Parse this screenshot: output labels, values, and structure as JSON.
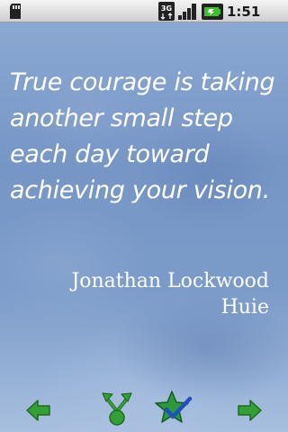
{
  "status_bar": {
    "network_label": "3G",
    "time": "1:51 AM",
    "icons": [
      "sd-card-icon",
      "3g-data-icon",
      "signal-strength-icon",
      "battery-charging-icon"
    ]
  },
  "quote": {
    "text": "True courage is taking another small step each day toward achieving your vision.",
    "author": "Jonathan Lockwood Huie"
  },
  "toolbar": {
    "buttons": [
      {
        "name": "previous-button",
        "icon": "arrow-left-icon"
      },
      {
        "name": "share-button",
        "icon": "share-icon"
      },
      {
        "name": "favorite-button",
        "icon": "star-check-icon"
      },
      {
        "name": "next-button",
        "icon": "arrow-right-icon"
      }
    ]
  },
  "colors": {
    "background": "#7e9fcb",
    "quote_text": "#ffffff",
    "toolbar_arrow": "#2f9a2f",
    "favorite_star": "#2d9a3a",
    "check_mark": "#1f4fc0"
  }
}
